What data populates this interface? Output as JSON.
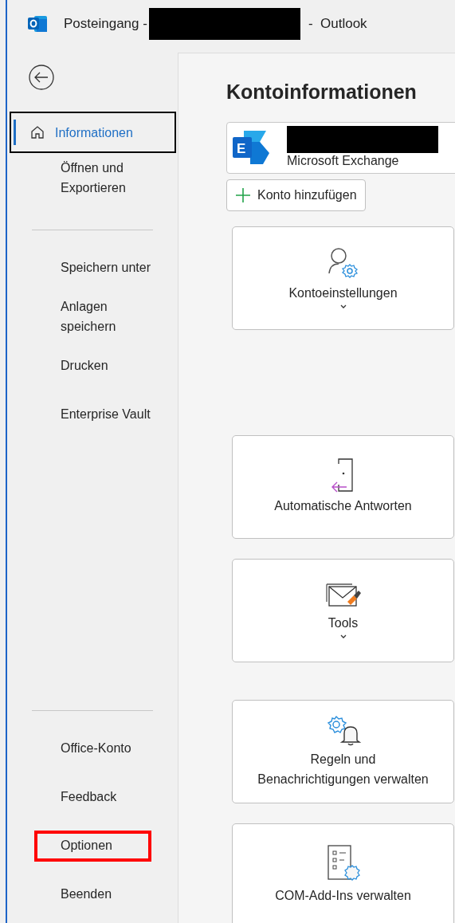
{
  "window": {
    "title_start": "Posteingang -",
    "title_redacted": true,
    "title_end": "-  Outlook"
  },
  "nav": {
    "groups": [
      {
        "items": [
          {
            "label": "Informationen",
            "kind": "home",
            "selected": true,
            "focused": true,
            "marked": false
          },
          {
            "label": "Öffnen und\nExportieren",
            "selected": false,
            "focused": false,
            "marked": false
          }
        ]
      },
      {
        "items": [
          {
            "label": "Speichern unter",
            "selected": false,
            "focused": false,
            "marked": false
          },
          {
            "label": "Anlagen\nspeichern",
            "selected": false,
            "focused": false,
            "marked": false
          },
          {
            "label": "Drucken",
            "selected": false,
            "focused": false,
            "marked": false
          },
          {
            "label": "Enterprise Vault",
            "selected": false,
            "focused": false,
            "marked": false
          }
        ]
      },
      {
        "items": [
          {
            "label": "Office-Konto",
            "selected": false,
            "focused": false,
            "marked": false
          },
          {
            "label": "Feedback",
            "selected": false,
            "focused": false,
            "marked": false
          },
          {
            "label": "Optionen",
            "selected": false,
            "focused": false,
            "marked": true
          },
          {
            "label": "Beenden",
            "selected": false,
            "focused": false,
            "marked": false
          }
        ]
      }
    ]
  },
  "main": {
    "heading": "Kontoinformationen",
    "account": {
      "logo_letter": "E",
      "name_redacted": true,
      "type": "Microsoft Exchange"
    },
    "add_button": {
      "label": "Konto hinzufügen"
    },
    "tiles": [
      {
        "label": "Kontoeinstellungen",
        "kind": "account",
        "dropdown": true
      },
      {
        "label": "Automatische Antworten",
        "kind": "reply",
        "dropdown": false
      },
      {
        "label": "Tools",
        "kind": "tools",
        "dropdown": true
      },
      {
        "label": "Regeln und\nBenachrichtigungen verwalten",
        "kind": "rules",
        "dropdown": false
      },
      {
        "label": "COM-Add-Ins verwalten",
        "kind": "addins",
        "dropdown": false
      }
    ]
  }
}
